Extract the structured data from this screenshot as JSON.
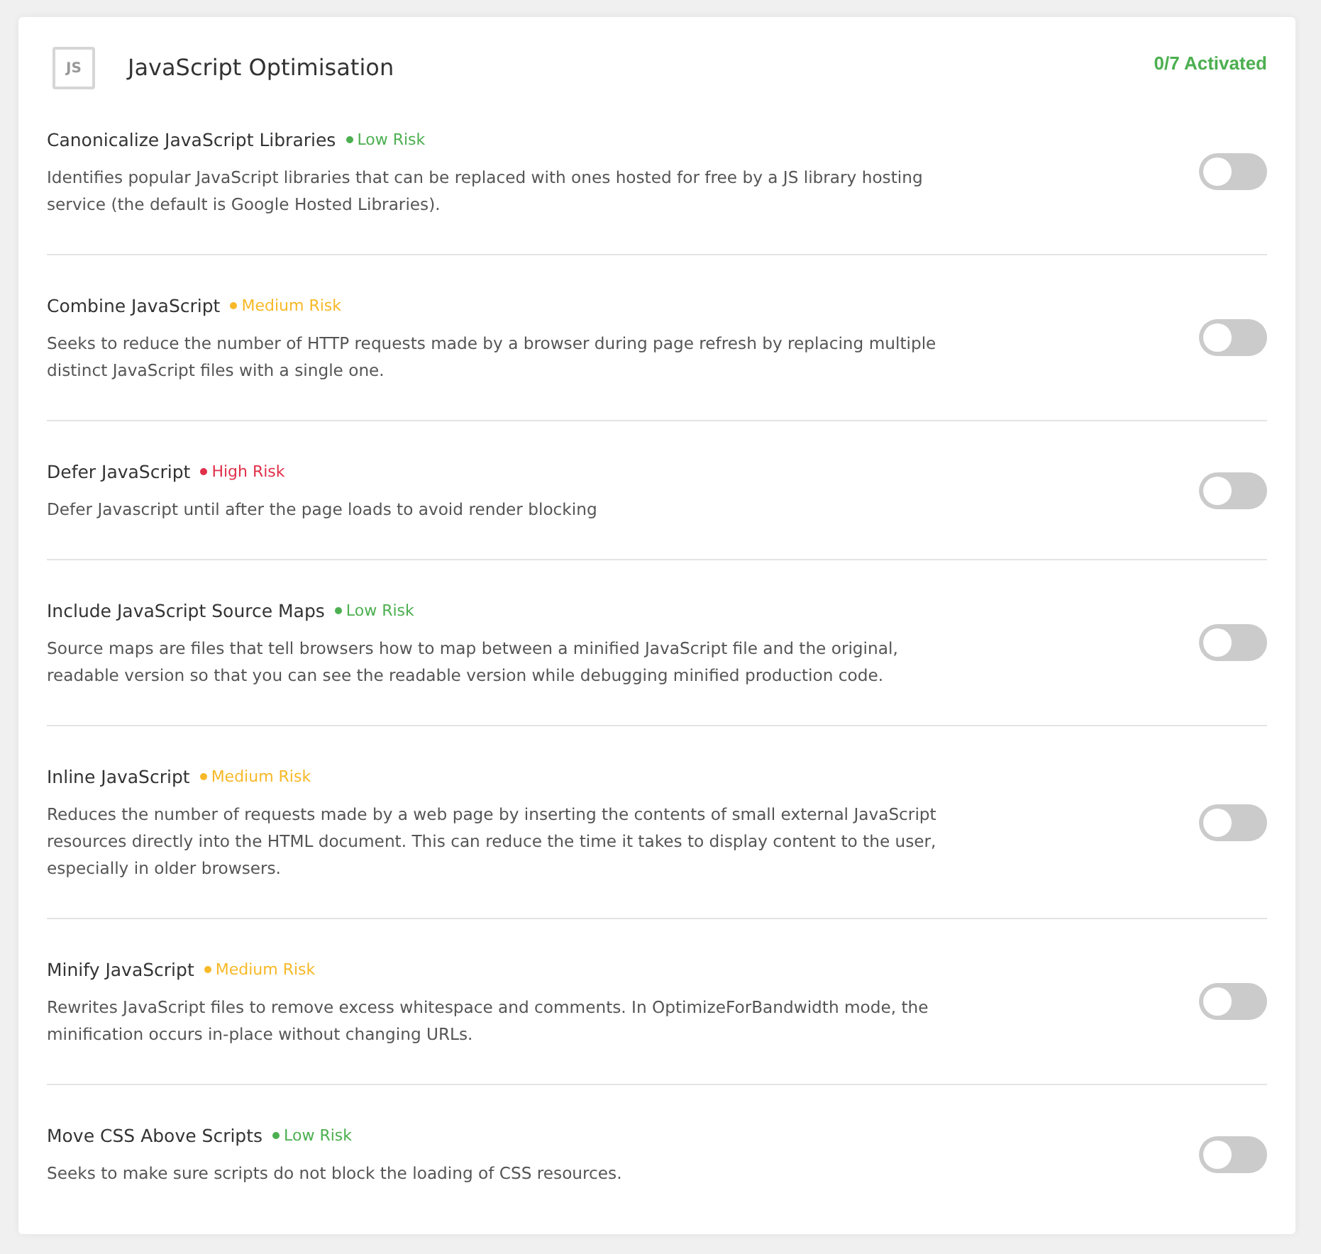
{
  "panel": {
    "icon_text": "JS",
    "title": "JavaScript Optimisation",
    "activated": "0/7 Activated"
  },
  "options": [
    {
      "title": "Canonicalize JavaScript Libraries",
      "risk": "Low Risk",
      "color": "#4caf50",
      "description": "Identifies popular JavaScript libraries that can be replaced with ones hosted for free by a JS library hosting service (the default is Google Hosted Libraries).",
      "on": false
    },
    {
      "title": "Combine JavaScript",
      "risk": "Medium Risk",
      "color": "#f7b928",
      "description": "Seeks to reduce the number of HTTP requests made by a browser during page refresh by replacing multiple distinct JavaScript files with a single one.",
      "on": false
    },
    {
      "title": "Defer JavaScript",
      "risk": "High Risk",
      "color": "#e0304a",
      "description": "Defer Javascript until after the page loads to avoid render blocking",
      "on": false
    },
    {
      "title": "Include JavaScript Source Maps",
      "risk": "Low Risk",
      "color": "#4caf50",
      "description": "Source maps are files that tell browsers how to map between a minified JavaScript file and the original, readable version so that you can see the readable version while debugging minified production code.",
      "on": false
    },
    {
      "title": "Inline JavaScript",
      "risk": "Medium Risk",
      "color": "#f7b928",
      "description": "Reduces the number of requests made by a web page by inserting the contents of small external JavaScript resources directly into the HTML document. This can reduce the time it takes to display content to the user, especially in older browsers.",
      "on": false
    },
    {
      "title": "Minify JavaScript",
      "risk": "Medium Risk",
      "color": "#f7b928",
      "description": "Rewrites JavaScript files to remove excess whitespace and comments. In OptimizeForBandwidth mode, the minification occurs in-place without changing URLs.",
      "on": false
    },
    {
      "title": "Move CSS Above Scripts",
      "risk": "Low Risk",
      "color": "#4caf50",
      "description": "Seeks to make sure scripts do not block the loading of CSS resources.",
      "on": false
    }
  ]
}
